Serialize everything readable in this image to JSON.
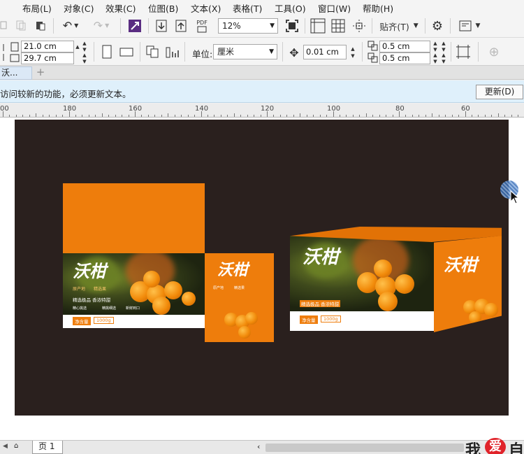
{
  "menu": [
    "布局(L)",
    "对象(C)",
    "效果(C)",
    "位图(B)",
    "文本(X)",
    "表格(T)",
    "工具(O)",
    "窗口(W)",
    "帮助(H)"
  ],
  "toolbar": {
    "zoom": "12%",
    "snap_label": "贴齐(T)",
    "pdf_label": "PDF"
  },
  "props": {
    "width": "21.0 cm",
    "height": "29.7 cm",
    "unit_label": "单位:",
    "unit_value": "厘米",
    "nudge": "0.01 cm",
    "dup_x": "0.5 cm",
    "dup_y": "0.5 cm"
  },
  "tabs": {
    "doc": "沃...",
    "add": "+"
  },
  "info": {
    "message": "访问较新的功能，必须更新文本。",
    "button": "更新(D)"
  },
  "ruler": [
    "00",
    "180",
    "160",
    "140",
    "120",
    "100",
    "80",
    "60"
  ],
  "artwork": {
    "title": "沃柑",
    "small1": "原产地",
    "small2": "精选果",
    "banner": "精选极品 香浓特甜",
    "tag1": "精心挑选",
    "tag2": "精挑细选",
    "tag3": "新鲜到口",
    "net_label": "净含量",
    "net_value": "1000g"
  },
  "status": {
    "page_tab": "页 1",
    "watermark1": "我",
    "watermark2": "爱",
    "watermark3": "自"
  },
  "colors": {
    "accent_orange": "#ee7d0c",
    "page_bg": "#2a201e",
    "info_bg": "#dff0fb"
  }
}
